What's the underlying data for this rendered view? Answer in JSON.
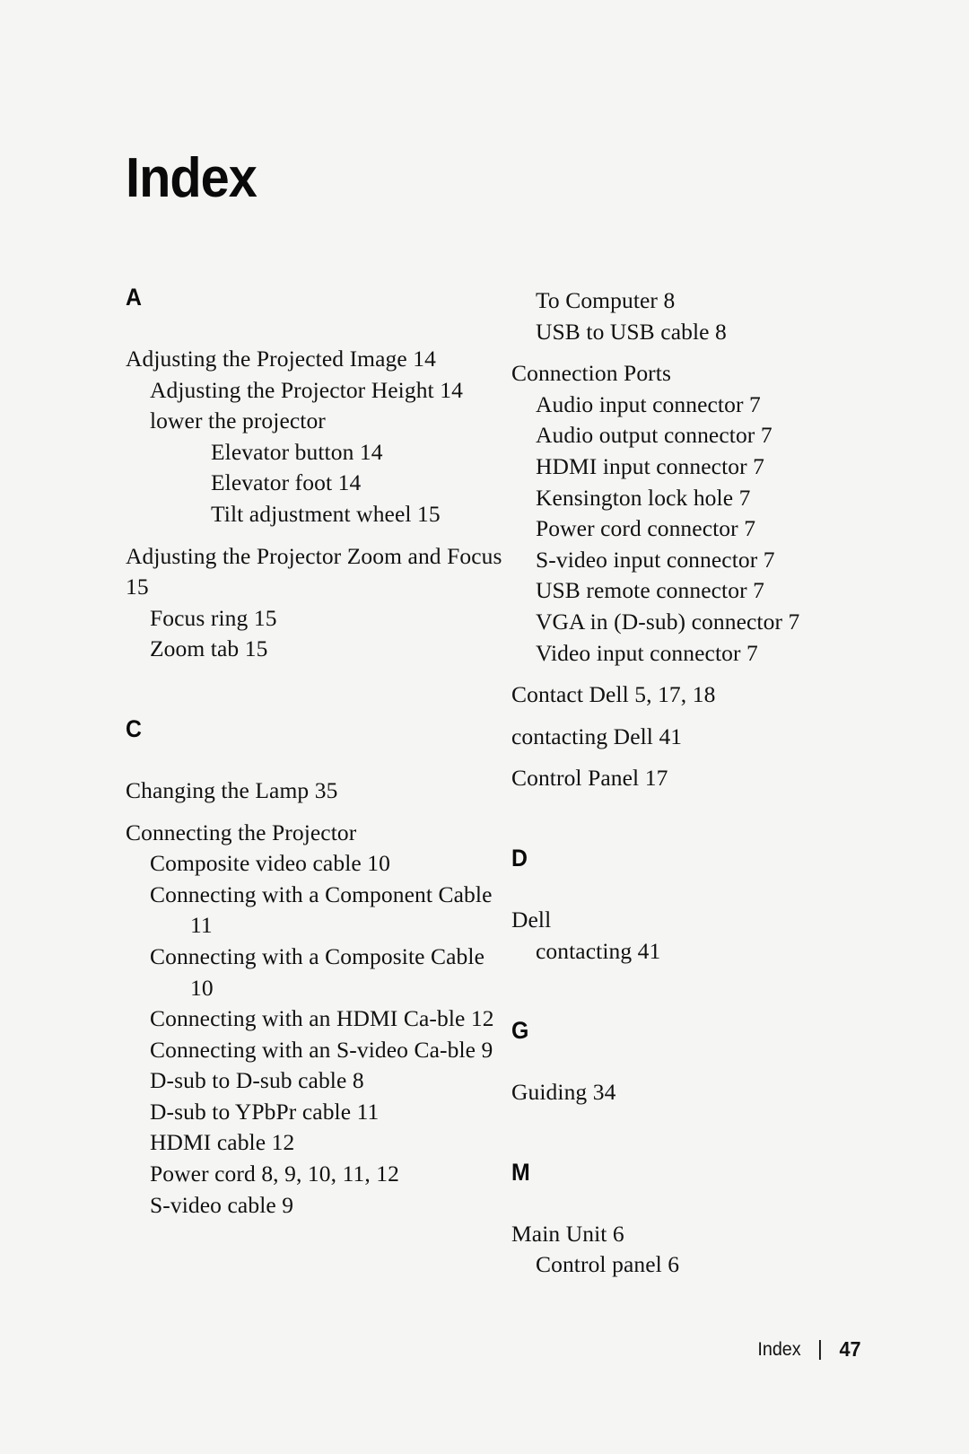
{
  "document": {
    "title": "Index"
  },
  "footer": {
    "label": "Index",
    "separator": "|",
    "page_number": "47"
  },
  "columns": [
    {
      "name": "left-column",
      "sections": [
        {
          "letter": "A",
          "entries": [
            {
              "level": 0,
              "text": "Adjusting the Projected Image  14"
            },
            {
              "level": 1,
              "text": "Adjusting the Projector Height 14"
            },
            {
              "level": 1,
              "text": "lower the projector"
            },
            {
              "level": 2,
              "text": "Elevator button  14"
            },
            {
              "level": 2,
              "text": "Elevator foot  14"
            },
            {
              "level": 2,
              "text": "Tilt adjustment wheel 15"
            },
            {
              "level": 0,
              "text": "Adjusting the Projector Zoom and Focus 15"
            },
            {
              "level": 1,
              "text": "Focus ring  15"
            },
            {
              "level": 1,
              "text": "Zoom tab 15"
            }
          ]
        },
        {
          "letter": "C",
          "entries": [
            {
              "level": 0,
              "text": "Changing the Lamp  35"
            },
            {
              "level": 0,
              "text": "Connecting the Projector"
            },
            {
              "level": 1,
              "text": "Composite video cable  10"
            },
            {
              "level": 1,
              "text": "Connecting with a Component Cable  11"
            },
            {
              "level": 1,
              "text": "Connecting with a Composite Cable  10"
            },
            {
              "level": 1,
              "text": "Connecting with an HDMI Ca-ble  12"
            },
            {
              "level": 1,
              "text": "Connecting with an S-video Ca-ble  9"
            },
            {
              "level": 1,
              "text": "D-sub to D-sub cable  8"
            },
            {
              "level": 1,
              "text": "D-sub to YPbPr cable  11"
            },
            {
              "level": 1,
              "text": "HDMI cable  12"
            },
            {
              "level": 1,
              "text": "Power cord 8, 9, 10, 11, 12"
            },
            {
              "level": 1,
              "text": "S-video cable  9"
            }
          ]
        }
      ]
    },
    {
      "name": "right-column",
      "sections": [
        {
          "letter": "",
          "entries": [
            {
              "level": 1,
              "text": "To Computer  8"
            },
            {
              "level": 1,
              "text": "USB to USB cable  8"
            },
            {
              "level": 0,
              "text": "Connection Ports"
            },
            {
              "level": 1,
              "text": "Audio input connector  7"
            },
            {
              "level": 1,
              "text": "Audio output connector  7"
            },
            {
              "level": 1,
              "text": "HDMI input connector  7"
            },
            {
              "level": 1,
              "text": "Kensington lock hole  7"
            },
            {
              "level": 1,
              "text": "Power cord connector  7"
            },
            {
              "level": 1,
              "text": "S-video input connector  7"
            },
            {
              "level": 1,
              "text": "USB remote connector  7"
            },
            {
              "level": 1,
              "text": "VGA in (D-sub) connector  7"
            },
            {
              "level": 1,
              "text": "Video input connector  7"
            },
            {
              "level": 0,
              "text": "Contact Dell 5, 17, 18"
            },
            {
              "level": 0,
              "text": "contacting Dell 41"
            },
            {
              "level": 0,
              "text": "Control Panel 17"
            }
          ]
        },
        {
          "letter": "D",
          "entries": [
            {
              "level": 0,
              "text": "Dell"
            },
            {
              "level": 1,
              "text": "contacting  41"
            }
          ]
        },
        {
          "letter": "G",
          "entries": [
            {
              "level": 0,
              "text": "Guiding  34"
            }
          ]
        },
        {
          "letter": "M",
          "entries": [
            {
              "level": 0,
              "text": "Main Unit 6"
            },
            {
              "level": 1,
              "text": "Control panel 6"
            }
          ]
        }
      ]
    }
  ]
}
